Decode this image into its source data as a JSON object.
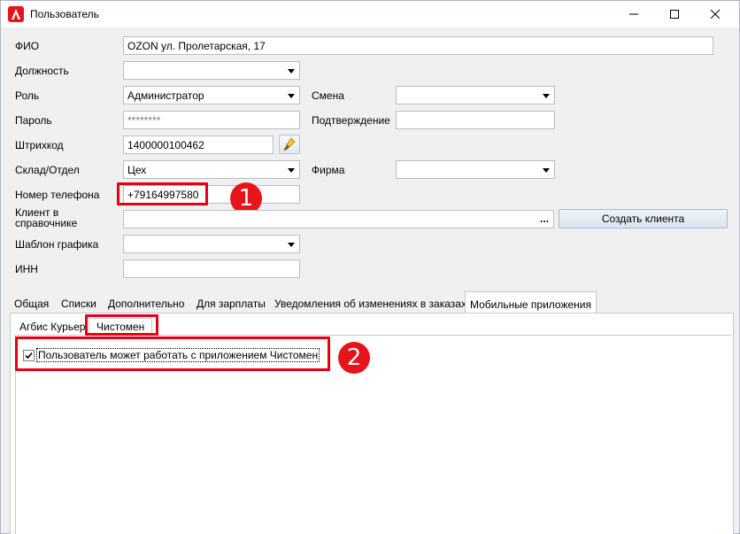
{
  "window": {
    "title": "Пользователь",
    "controls": {
      "minimize": "minimize-icon",
      "maximize": "maximize-icon",
      "close": "close-icon"
    },
    "accent_color": "#e8141c"
  },
  "form": {
    "fio": {
      "label": "ФИО",
      "value": "OZON ул. Пролетарская, 17"
    },
    "position": {
      "label": "Должность",
      "value": ""
    },
    "role": {
      "label": "Роль",
      "value": "Администратор"
    },
    "shift": {
      "label": "Смена",
      "value": ""
    },
    "password": {
      "label": "Пароль",
      "value": "********"
    },
    "confirm": {
      "label": "Подтверждение",
      "value": ""
    },
    "barcode": {
      "label": "Штрихкод",
      "value": "1400000100462"
    },
    "warehouse": {
      "label": "Склад/Отдел",
      "value": "Цех"
    },
    "firm": {
      "label": "Фирма",
      "value": ""
    },
    "phone": {
      "label": "Номер телефона",
      "value": "+79164997580"
    },
    "client": {
      "label": "Клиент в справочнике",
      "value": "",
      "ellipsis": "...",
      "create_button": "Создать клиента"
    },
    "schedule": {
      "label": "Шаблон графика",
      "value": ""
    },
    "inn": {
      "label": "ИНН",
      "value": ""
    }
  },
  "tabs": [
    {
      "label": "Общая",
      "active": false
    },
    {
      "label": "Списки",
      "active": false
    },
    {
      "label": "Дополнительно",
      "active": false
    },
    {
      "label": "Для зарплаты",
      "active": false
    },
    {
      "label": "Уведомления об изменениях в заказах",
      "active": false
    },
    {
      "label": "Мобильные приложения",
      "active": true
    }
  ],
  "subtabs": [
    {
      "label": "Агбис Курьер",
      "active": false
    },
    {
      "label": "Чистомен",
      "active": true
    }
  ],
  "chistomen": {
    "checkbox_label": "Пользователь может работать с приложением Чистомен",
    "checked": true
  },
  "annotations": {
    "badge1": "1",
    "badge2": "2"
  }
}
